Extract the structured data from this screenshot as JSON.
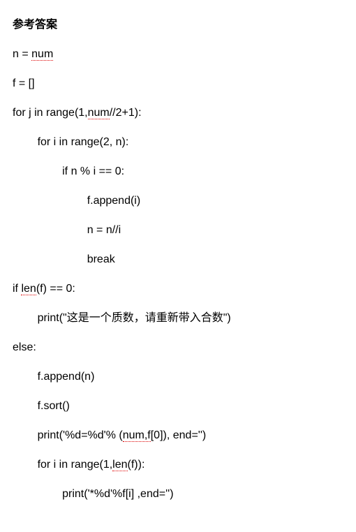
{
  "title": "参考答案",
  "lines": [
    {
      "indent": 0,
      "segments": [
        {
          "t": "n = "
        },
        {
          "t": "num",
          "u": true
        }
      ]
    },
    {
      "indent": 0,
      "segments": [
        {
          "t": "f = []"
        }
      ]
    },
    {
      "indent": 0,
      "segments": [
        {
          "t": "for j in range(1,"
        },
        {
          "t": "num",
          "u": true
        },
        {
          "t": "//2+1):"
        }
      ]
    },
    {
      "indent": 1,
      "segments": [
        {
          "t": "for i in range(2, n):"
        }
      ]
    },
    {
      "indent": 2,
      "segments": [
        {
          "t": "if n % i == 0:"
        }
      ]
    },
    {
      "indent": 3,
      "segments": [
        {
          "t": "f.append(i)"
        }
      ]
    },
    {
      "indent": 3,
      "segments": [
        {
          "t": "n = n//i"
        }
      ]
    },
    {
      "indent": 3,
      "segments": [
        {
          "t": "break"
        }
      ]
    },
    {
      "indent": 0,
      "segments": [
        {
          "t": "if "
        },
        {
          "t": "len",
          "u": true
        },
        {
          "t": "(f) == 0:"
        }
      ]
    },
    {
      "indent": 1,
      "segments": [
        {
          "t": "print(\"这是一个质数，请重新带入合数\")"
        }
      ]
    },
    {
      "indent": 0,
      "segments": [
        {
          "t": "else:"
        }
      ]
    },
    {
      "indent": 1,
      "segments": [
        {
          "t": "f.append(n)"
        }
      ]
    },
    {
      "indent": 1,
      "segments": [
        {
          "t": "f.sort()"
        }
      ]
    },
    {
      "indent": 1,
      "segments": [
        {
          "t": "print('%d=%d'% ("
        },
        {
          "t": "num,f",
          "u": true
        },
        {
          "t": "[0]), end='')"
        }
      ]
    },
    {
      "indent": 1,
      "segments": [
        {
          "t": "for i in range(1,"
        },
        {
          "t": "len",
          "u": true
        },
        {
          "t": "(f)):"
        }
      ]
    },
    {
      "indent": 2,
      "segments": [
        {
          "t": "print('*%d'%f[i] ,end='')"
        }
      ]
    }
  ],
  "indent_unit": "        "
}
